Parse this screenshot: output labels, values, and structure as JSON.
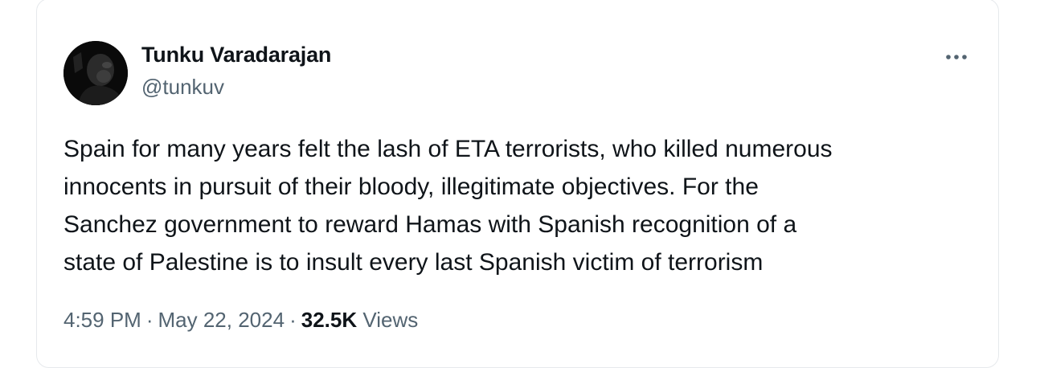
{
  "tweet": {
    "author": {
      "display_name": "Tunku Varadarajan",
      "handle": "@tunkuv",
      "avatar_icon": "profile-photo-icon"
    },
    "more_icon": "ellipsis-icon",
    "text": "Spain for many years felt the lash of ETA terrorists, who killed numerous\ninnocents in pursuit of their bloody, illegitimate objectives. For the\nSanchez government to reward Hamas with Spanish recognition of a\nstate of Palestine is to insult every last Spanish victim of terrorism",
    "meta": {
      "time": "4:59 PM",
      "separator": "·",
      "date": "May 22, 2024",
      "views_count": "32.5K",
      "views_label": "Views"
    }
  },
  "colors": {
    "text_primary": "#0f1419",
    "text_secondary": "#536471",
    "border": "#e6e9ec",
    "background": "#ffffff"
  }
}
